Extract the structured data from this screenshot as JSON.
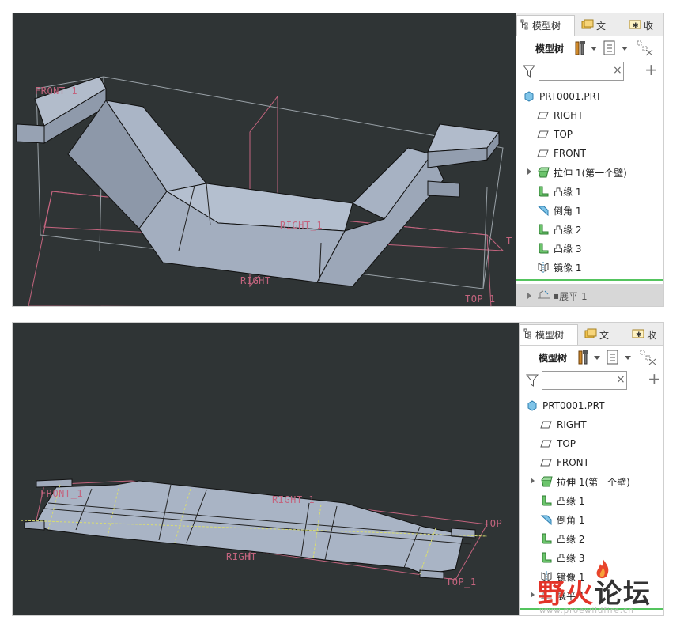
{
  "tree_panel": {
    "tabs": [
      {
        "label": "模型树",
        "icon": "model-tree-icon"
      },
      {
        "label": "文",
        "icon": "folder-browser-icon"
      },
      {
        "label": "收",
        "icon": "favorites-icon"
      }
    ],
    "toolbar_label": "模型树",
    "search_placeholder": "",
    "clear_glyph": "×",
    "add_glyph": "+",
    "root": {
      "label": "PRT0001.PRT",
      "icon": "part-icon"
    },
    "items": [
      {
        "label": "RIGHT",
        "icon": "datum-plane-icon",
        "expandable": false
      },
      {
        "label": "TOP",
        "icon": "datum-plane-icon",
        "expandable": false
      },
      {
        "label": "FRONT",
        "icon": "datum-plane-icon",
        "expandable": false
      },
      {
        "label": "拉伸 1(第一个壁)",
        "icon": "extrude-wall-icon",
        "expandable": true
      },
      {
        "label": "凸缘 1",
        "icon": "flange-icon",
        "expandable": false
      },
      {
        "label": "倒角 1",
        "icon": "chamfer-icon",
        "expandable": false
      },
      {
        "label": "凸缘 2",
        "icon": "flange-icon",
        "expandable": false
      },
      {
        "label": "凸缘 3",
        "icon": "flange-icon",
        "expandable": false
      },
      {
        "label": "镜像 1",
        "icon": "mirror-icon",
        "expandable": false
      }
    ],
    "last_item": {
      "label": "展平 1",
      "prefix": "▪",
      "icon": "flatten-icon"
    }
  },
  "viewport_top": {
    "labels": {
      "front": "FRONT_1",
      "right": "RIGHT",
      "right_inner": "RIGHT_1",
      "top": "TOP_1",
      "t": "T"
    }
  },
  "viewport_bottom": {
    "labels": {
      "front": "FRONT_1",
      "right": "RIGHT",
      "right_inner": "RIGHT_1",
      "top": "TOP",
      "top_inner": "TOP_1"
    }
  },
  "watermark": {
    "brand_red": "野火",
    "brand_dark": "论坛",
    "url": "www.proewildfire.cn"
  },
  "colors": {
    "viewport_bg": "#2f3435",
    "part_face": "#a9b4c5",
    "datum": "#c3647e",
    "accent_green": "#54c45e"
  }
}
